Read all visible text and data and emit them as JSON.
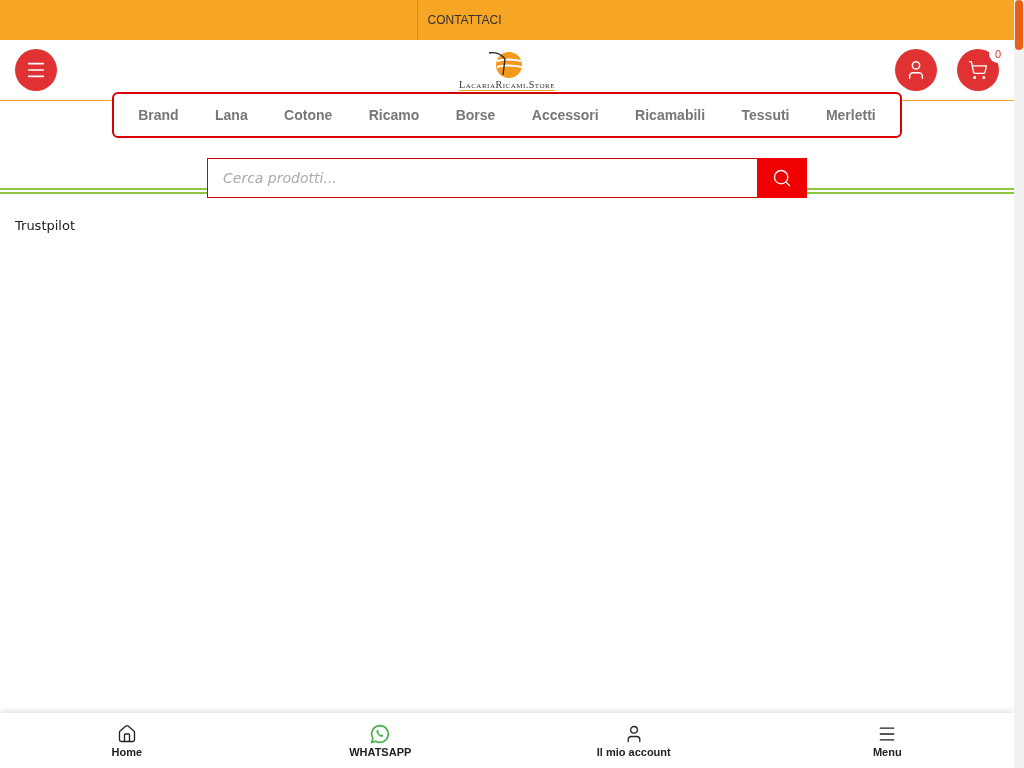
{
  "top_bar": {
    "link": "CONTATTACI"
  },
  "header": {
    "logo_text": "LacariaRicami.Store",
    "cart_count": "0"
  },
  "categories": [
    "Brand",
    "Lana",
    "Cotone",
    "Ricamo",
    "Borse",
    "Accessori",
    "Ricamabili",
    "Tessuti",
    "Merletti"
  ],
  "search": {
    "placeholder": "Cerca prodotti..."
  },
  "content": {
    "text": "Trustpilot"
  },
  "bottom_nav": [
    {
      "kind": "home",
      "label": "Home"
    },
    {
      "kind": "whatsapp",
      "label": "WHATSAPP"
    },
    {
      "kind": "account",
      "label": "Il mio account"
    },
    {
      "kind": "menu",
      "label": "Menu"
    }
  ]
}
